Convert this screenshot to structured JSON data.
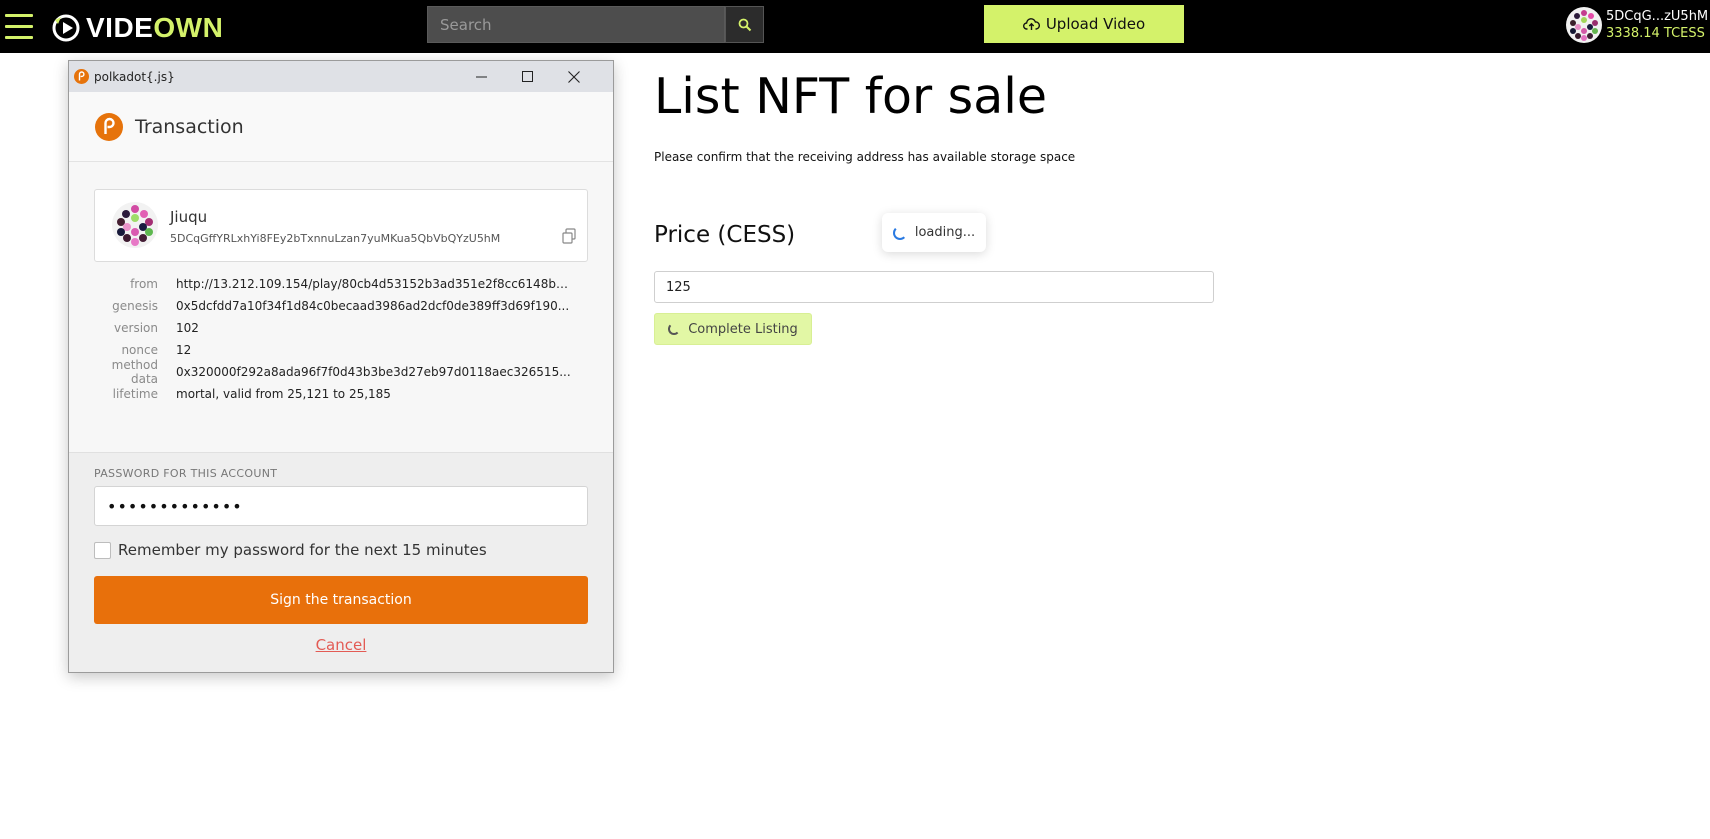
{
  "topbar": {
    "logo_part1": "VIDE",
    "logo_part2": "OWN",
    "search_placeholder": "Search",
    "upload_label": "Upload Video",
    "account_short": "5DCqG...zU5hM",
    "balance": "3338.14 TCESS",
    "accent_color": "#d4f26a"
  },
  "main": {
    "title": "List NFT for sale",
    "note": "Please confirm that the receiving address has available storage space",
    "price_label": "Price (CESS)",
    "loading_text": "loading...",
    "price_value": "125",
    "complete_label": "Complete Listing"
  },
  "popup": {
    "window_title": "polkadot{.js}",
    "header": "Transaction",
    "account_name": "Jiuqu",
    "account_address": "5DCqGffYRLxhYi8FEy2bTxnnuLzan7yuMKua5QbVbQYzU5hM",
    "details": [
      {
        "key": "from",
        "value": "http://13.212.109.154/play/80cb4d53152b3ad351e2f8cc6148bb..."
      },
      {
        "key": "genesis",
        "value": "0x5dcfdd7a10f34f1d84c0becaad3986ad2dcf0de389ff3d69f190..."
      },
      {
        "key": "version",
        "value": "102"
      },
      {
        "key": "nonce",
        "value": "12"
      },
      {
        "key": "method data",
        "value": "0x320000f292a8ada96f7f0d43b3be3d27eb97d0118aec326515..."
      },
      {
        "key": "lifetime",
        "value": "mortal, valid from 25,121 to 25,185"
      }
    ],
    "password_label": "PASSWORD FOR THIS ACCOUNT",
    "password_value": "•••••••••••••",
    "remember_label": "Remember my password for the next 15 minutes",
    "sign_label": "Sign the transaction",
    "cancel_label": "Cancel",
    "brand_color": "#e6730b"
  }
}
